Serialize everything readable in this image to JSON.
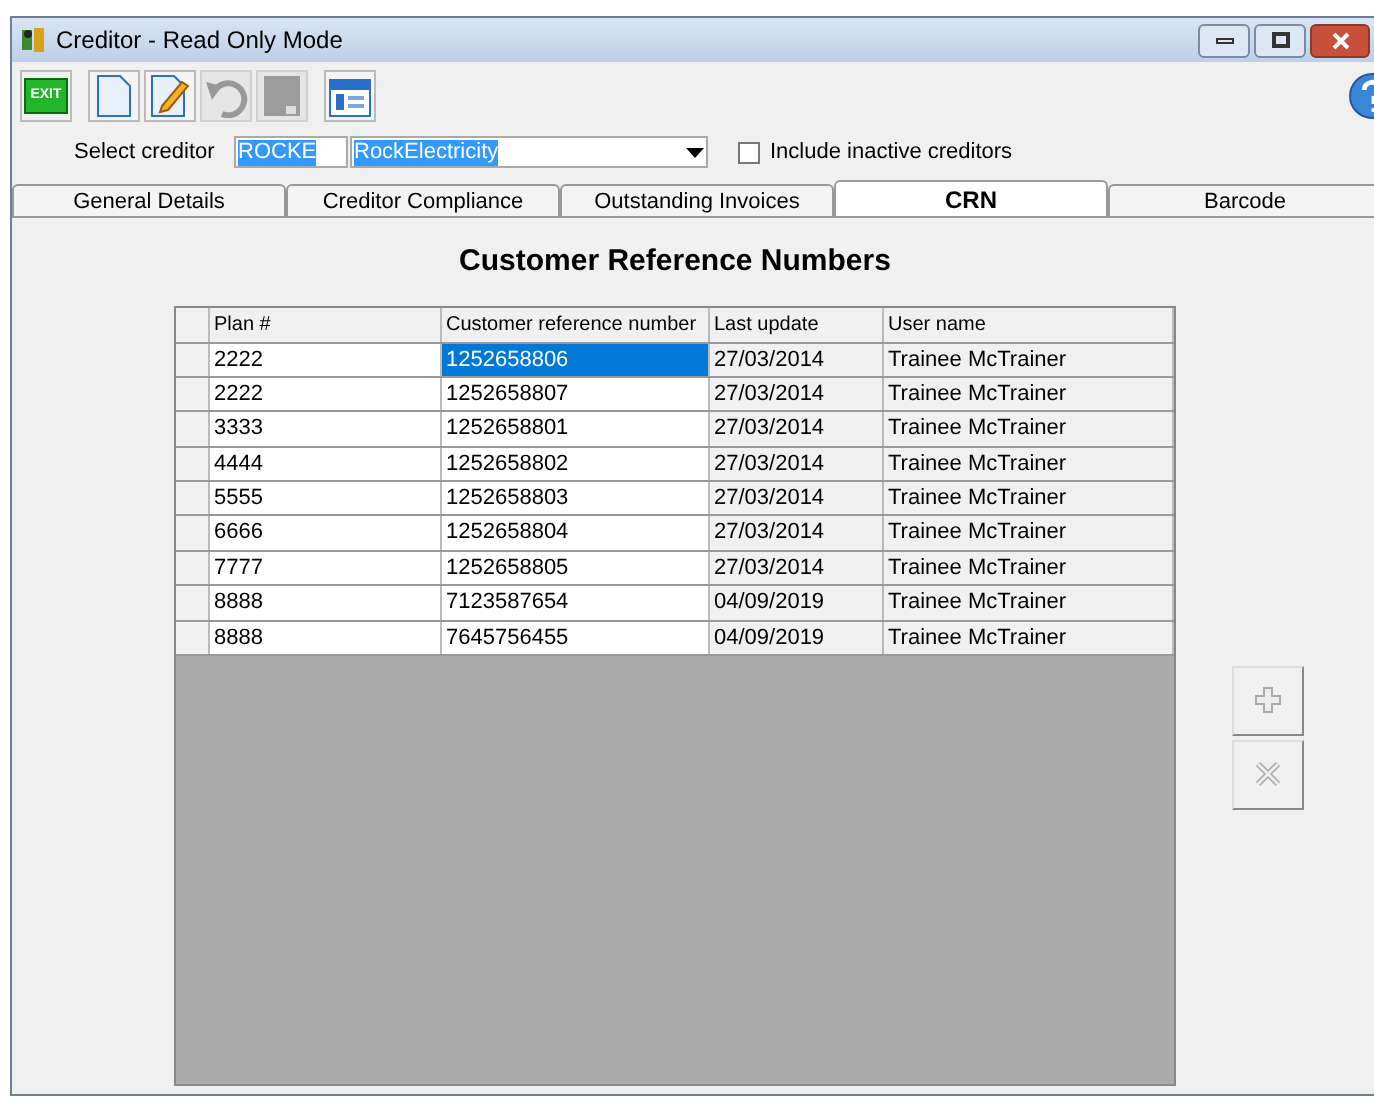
{
  "window": {
    "title": "Creditor - Read Only Mode"
  },
  "toolbar": [
    {
      "kind": "exit",
      "label": "EXIT",
      "disabled": false
    },
    {
      "kind": "new",
      "disabled": false
    },
    {
      "kind": "edit",
      "disabled": false
    },
    {
      "kind": "undo",
      "disabled": true
    },
    {
      "kind": "save",
      "disabled": true
    },
    {
      "kind": "calendar",
      "disabled": false
    }
  ],
  "selector": {
    "label": "Select creditor",
    "code": "ROCKE",
    "name": "RockElectricity",
    "include_inactive": {
      "label": "Include inactive creditors",
      "checked": false
    }
  },
  "tabs": [
    {
      "label": "General Details",
      "selected": false
    },
    {
      "label": "Creditor Compliance",
      "selected": false
    },
    {
      "label": "Outstanding Invoices",
      "selected": false
    },
    {
      "label": "CRN",
      "selected": true
    },
    {
      "label": "Barcode",
      "selected": false
    }
  ],
  "heading": "Customer Reference Numbers",
  "table": {
    "columns": [
      "Plan #",
      "Customer reference number",
      "Last update",
      "User name"
    ],
    "rows": [
      {
        "cells": [
          "2222",
          "1252658806",
          "27/03/2014",
          "Trainee McTrainer"
        ],
        "selected": true
      },
      {
        "cells": [
          "2222",
          "1252658807",
          "27/03/2014",
          "Trainee McTrainer"
        ],
        "selected": false
      },
      {
        "cells": [
          "3333",
          "1252658801",
          "27/03/2014",
          "Trainee McTrainer"
        ],
        "selected": false
      },
      {
        "cells": [
          "4444",
          "1252658802",
          "27/03/2014",
          "Trainee McTrainer"
        ],
        "selected": false
      },
      {
        "cells": [
          "5555",
          "1252658803",
          "27/03/2014",
          "Trainee McTrainer"
        ],
        "selected": false
      },
      {
        "cells": [
          "6666",
          "1252658804",
          "27/03/2014",
          "Trainee McTrainer"
        ],
        "selected": false
      },
      {
        "cells": [
          "7777",
          "1252658805",
          "27/03/2014",
          "Trainee McTrainer"
        ],
        "selected": false
      },
      {
        "cells": [
          "8888",
          "7123587654",
          "04/09/2019",
          "Trainee McTrainer"
        ],
        "selected": false
      },
      {
        "cells": [
          "8888",
          "7645756455",
          "04/09/2019",
          "Trainee McTrainer"
        ],
        "selected": false
      }
    ]
  },
  "side_buttons": [
    {
      "kind": "add",
      "disabled": true
    },
    {
      "kind": "delete",
      "disabled": true
    }
  ]
}
